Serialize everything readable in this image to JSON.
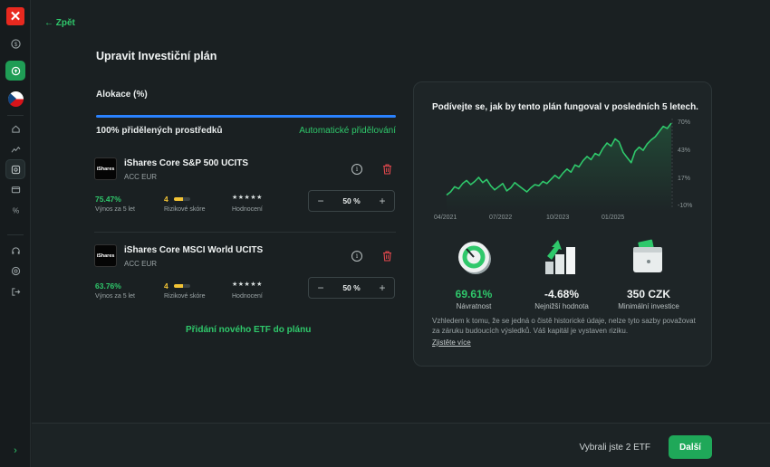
{
  "nav": {
    "back_label": "Zpět"
  },
  "page": {
    "title": "Upravit Investiční plán"
  },
  "allocation": {
    "label": "Alokace (%)",
    "status": "100% přidělených prostředků",
    "auto_label": "Automatické přidělování",
    "progress": 1.0,
    "bar_color": "#2a82ff"
  },
  "etfs": [
    {
      "logo_text": "iShares",
      "name": "iShares Core S&P 500 UCITS",
      "sub": "ACC EUR",
      "return_value": "75.47%",
      "return_label": "Výnos za 5 let",
      "risk_value": "4",
      "risk_fraction": 0.57,
      "risk_label": "Rizikové skóre",
      "stars": "★★★★★",
      "rating_label": "Hodnocení",
      "decrement": "−",
      "increment": "+",
      "allocation": "50 %"
    },
    {
      "logo_text": "iShares",
      "name": "iShares Core MSCI World UCITS",
      "sub": "ACC EUR",
      "return_value": "63.76%",
      "return_label": "Výnos za 5 let",
      "risk_value": "4",
      "risk_fraction": 0.57,
      "risk_label": "Rizikové skóre",
      "stars": "★★★★★",
      "rating_label": "Hodnocení",
      "decrement": "−",
      "increment": "+",
      "allocation": "50 %"
    }
  ],
  "add_etf_label": "Přidání nového ETF do plánu",
  "panel": {
    "title": "Podívejte se, jak by tento plán fungoval v posledních 5 letech.",
    "metrics": [
      {
        "value": "69.61%",
        "label": "Návratnost",
        "color": "#2fc86b",
        "icon": "return-ring-icon"
      },
      {
        "value": "-4.68%",
        "label": "Nejnižší hodnota",
        "color": "#f1f4f4",
        "icon": "bar-arrow-icon"
      },
      {
        "value": "350 CZK",
        "label": "Minimální investice",
        "color": "#f1f4f4",
        "icon": "wallet-icon"
      }
    ],
    "disclaimer": "Vzhledem k tomu, že se jedná o čistě historické údaje, nelze tyto sazby považovat za záruku budoucích výsledků. Váš kapitál je vystaven riziku.",
    "learn_more": "Zjistěte více"
  },
  "chart_data": {
    "type": "area",
    "x_ticks": [
      "04/2021",
      "07/2022",
      "10/2023",
      "01/2025"
    ],
    "y_ticks": [
      "70%",
      "43%",
      "17%",
      "-10%"
    ],
    "ylim": [
      -10,
      70
    ],
    "line_color": "#2fc86b",
    "series": [
      {
        "values": [
          0,
          3,
          8,
          6,
          11,
          14,
          10,
          13,
          17,
          12,
          15,
          9,
          5,
          8,
          11,
          4,
          7,
          12,
          9,
          6,
          3,
          7,
          10,
          9,
          13,
          11,
          15,
          19,
          16,
          21,
          25,
          22,
          29,
          27,
          33,
          37,
          34,
          40,
          38,
          45,
          50,
          47,
          54,
          51,
          41,
          36,
          31,
          42,
          46,
          43,
          49,
          53,
          56,
          61,
          66,
          64,
          69
        ]
      }
    ]
  },
  "footer": {
    "selection_text": "Vybrali jste 2 ETF",
    "next_label": "Další"
  }
}
